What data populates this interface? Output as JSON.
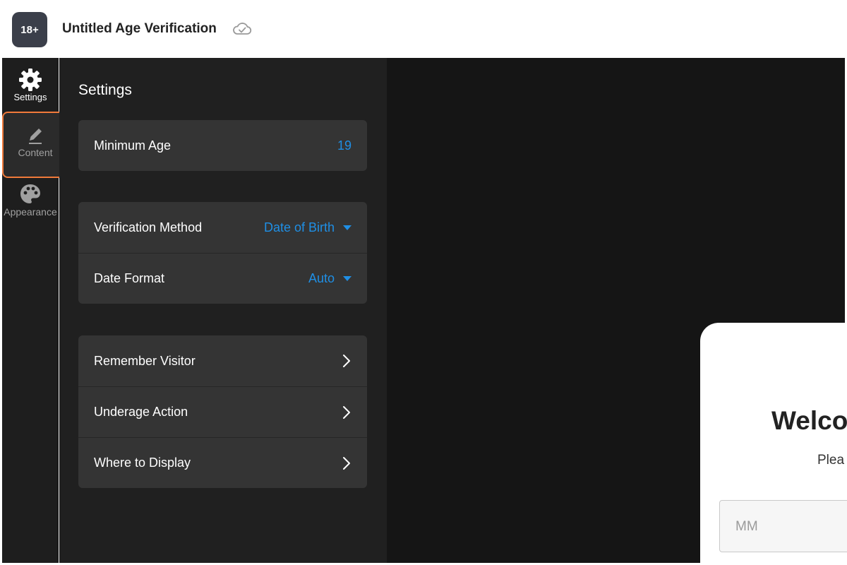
{
  "header": {
    "logo_text": "18+",
    "title": "Untitled Age Verification",
    "sync_icon": "cloud-check-icon"
  },
  "rail": {
    "items": [
      {
        "label": "Settings",
        "icon": "gear-icon"
      },
      {
        "label": "Content",
        "icon": "pencil-icon"
      },
      {
        "label": "Appearance",
        "icon": "palette-icon"
      }
    ]
  },
  "panel": {
    "title": "Settings",
    "minimum_age": {
      "label": "Minimum Age",
      "value": "19"
    },
    "verification_method": {
      "label": "Verification Method",
      "value": "Date of Birth"
    },
    "date_format": {
      "label": "Date Format",
      "value": "Auto"
    },
    "links": [
      {
        "label": "Remember Visitor"
      },
      {
        "label": "Underage Action"
      },
      {
        "label": "Where to Display"
      }
    ]
  },
  "preview": {
    "heading": "Welco",
    "subtext": "Plea",
    "month_placeholder": "MM"
  },
  "colors": {
    "accent": "#1f8fe5",
    "highlight_border": "#f07a3a"
  }
}
